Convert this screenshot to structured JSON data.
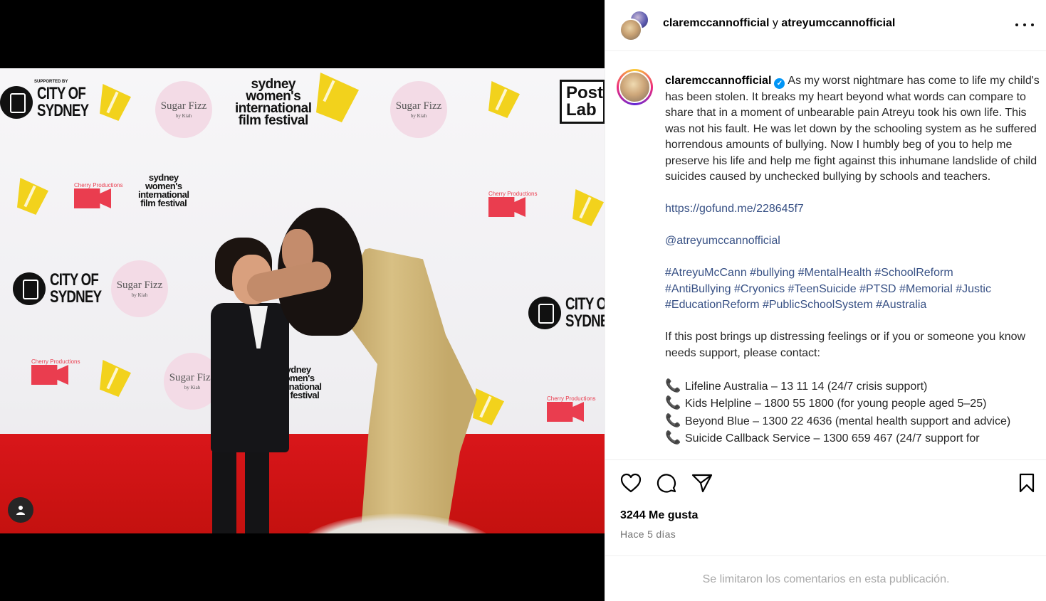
{
  "header": {
    "user1": "claremccannofficial",
    "conjunction": "y",
    "user2": "atreyumccannofficial"
  },
  "photo": {
    "logos": {
      "city_of": "CITY OF",
      "sydney": "SYDNEY",
      "supported_by": "SUPPORTED BY",
      "swiff_line1": "sydney",
      "swiff_line2": "women's",
      "swiff_line3": "international",
      "swiff_line4": "film festival",
      "sugar_fizz": "Sugar Fizz",
      "by_kiah": "by Kiah",
      "cherry": "Cherry Productions",
      "postlab_1": "Post",
      "postlab_2": "Lab"
    }
  },
  "caption": {
    "username": "claremccannofficial",
    "text": "As my worst nightmare has come to life my child's has been stolen. It breaks my heart beyond what words can compare to share that in a moment of unbearable pain Atreyu took his own life. This was not his fault. He was let down by the schooling system as he suffered horrendous amounts of bullying. Now I humbly beg of you to help me preserve his life and help me fight against this inhumane landslide of child suicides caused by unchecked bullying by schools and teachers.",
    "link": "https://gofund.me/228645f7",
    "mention": "@atreyumccannofficial",
    "hashtags_line1": "#AtreyuMcCann #bullying #MentalHealth #SchoolReform",
    "hashtags_line2": "#AntiBullying #Cryonics #TeenSuicide #PTSD #Memorial #Justic",
    "hashtags_line3": "#EducationReform #PublicSchoolSystem #Australia",
    "support_intro": "If this post brings up distressing feelings or if you or someone you know needs support, please contact:",
    "contacts": [
      "Lifeline Australia – 13 11 14 (24/7 crisis support)",
      "Kids Helpline – 1800 55 1800 (for young people aged 5–25)",
      "Beyond Blue – 1300 22 4636 (mental health support and advice)",
      "Suicide Callback Service – 1300 659 467 (24/7 support for"
    ]
  },
  "stats": {
    "likes": "3244 Me gusta",
    "time": "Hace 5 días"
  },
  "footer": {
    "comments_limited": "Se limitaron los comentarios en esta publicación."
  },
  "colors": {
    "accent_link": "#385185",
    "verified": "#0095f6",
    "carpet": "#d9161a",
    "wheat": "#f2d21c"
  },
  "icons": {
    "like": "heart-icon",
    "comment": "comment-icon",
    "share": "paper-plane-icon",
    "save": "bookmark-icon",
    "more": "more-dots-icon",
    "tagged": "person-icon"
  }
}
